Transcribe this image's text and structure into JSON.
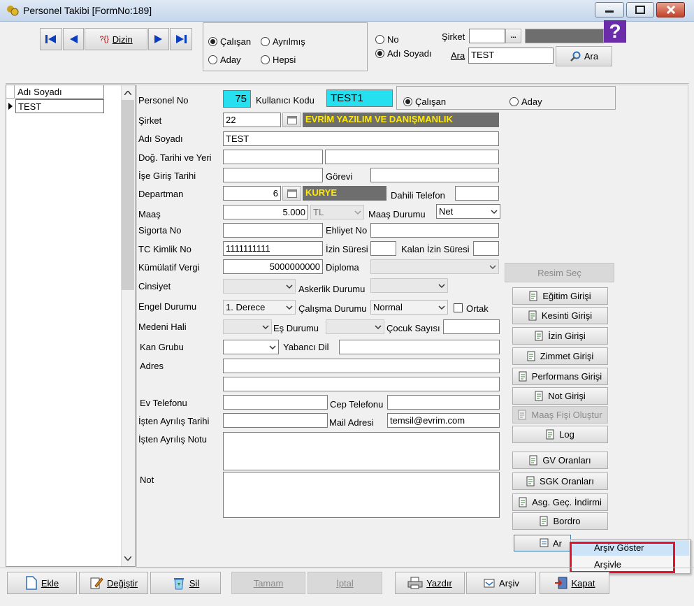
{
  "window": {
    "title": "Personel Takibi [FormNo:189]"
  },
  "nav": {
    "dizin_label": "Dizin",
    "dizin_prefix": "?{}"
  },
  "status_filter": {
    "calisan": "Çalışan",
    "ayrilmis": "Ayrılmış",
    "aday": "Aday",
    "hepsi": "Hepsi"
  },
  "search_mode": {
    "no": "No",
    "adi_soyadi": "Adı Soyadı"
  },
  "search": {
    "sirket_label": "Şirket",
    "sirket_value": "",
    "ellipsis": "...",
    "ara_label": "Ara",
    "ara_value": "TEST",
    "ara_button": "Ara",
    "help_symbol": "?"
  },
  "grid": {
    "header": "Adı Soyadı",
    "rows": [
      "TEST"
    ]
  },
  "form": {
    "personel_no_label": "Personel No",
    "personel_no": "75",
    "kullanici_kodu_label": "Kullanıcı Kodu",
    "kullanici_kodu": "TEST1",
    "type_calisan": "Çalışan",
    "type_aday": "Aday",
    "sirket_label": "Şirket",
    "sirket_no": "22",
    "sirket_name": "EVRİM YAZILIM VE DANIŞMANLIK",
    "adi_soyadi_label": "Adı Soyadı",
    "adi_soyadi": "TEST",
    "dogum_label": "Doğ. Tarihi ve Yeri",
    "ise_giris_label": "İşe Giriş Tarihi",
    "gorevi_label": "Görevi",
    "departman_label": "Departman",
    "departman_no": "6",
    "departman_name": "KURYE",
    "dahili_label": "Dahili Telefon",
    "maas_label": "Maaş",
    "maas": "5.000",
    "currency": "TL",
    "maas_durumu_label": "Maaş Durumu",
    "maas_durumu": "Net",
    "sigorta_label": "Sigorta No",
    "ehliyet_label": "Ehliyet No",
    "tc_label": "TC Kimlik No",
    "tc": "1111111111",
    "izin_suresi_label": "İzin Süresi",
    "kalan_izin_label": "Kalan İzin Süresi",
    "kumulatif_label": "Kümülatif Vergi",
    "kumulatif": "5000000000",
    "diploma_label": "Diploma",
    "cinsiyet_label": "Cinsiyet",
    "askerlik_label": "Askerlik Durumu",
    "engel_label": "Engel Durumu",
    "engel": "1. Derece",
    "calisma_label": "Çalışma Durumu",
    "calisma": "Normal",
    "ortak_label": "Ortak",
    "medeni_label": "Medeni Hali",
    "es_label": "Eş Durumu",
    "cocuk_label": "Çocuk Sayısı",
    "kan_label": "Kan Grubu",
    "yabanci_label": "Yabancı Dil",
    "adres_label": "Adres",
    "ev_tel_label": "Ev Telefonu",
    "cep_tel_label": "Cep Telefonu",
    "ayrilis_tarihi_label": "İşten Ayrılış Tarihi",
    "mail_label": "Mail Adresi",
    "mail": "temsil@evrim.com",
    "ayrilis_notu_label": "İşten Ayrılış Notu",
    "not_label": "Not"
  },
  "side_buttons": {
    "resim_sec": "Resim Seç",
    "egitim": "Eğitim Girişi",
    "kesinti": "Kesinti Girişi",
    "izin": "İzin Girişi",
    "zimmet": "Zimmet Girişi",
    "performans": "Performans Girişi",
    "not": "Not Girişi",
    "maas_fisi": "Maaş Fişi Oluştur",
    "log": "Log",
    "gv": "GV Oranları",
    "sgk": "SGK Oranları",
    "asg": "Asg. Geç. İndirmi",
    "bordro": "Bordro",
    "arsiv_partial": "Ar"
  },
  "context_menu": {
    "items": [
      "Arşiv Göster",
      "Arşivle"
    ],
    "highlight_color": "#e8102a"
  },
  "bottom_bar": {
    "ekle": "Ekle",
    "degistir": "Değiştir",
    "sil": "Sil",
    "tamam": "Tamam",
    "iptal": "İptal",
    "yazdir": "Yazdır",
    "arsiv": "Arşiv",
    "kapat": "Kapat"
  }
}
